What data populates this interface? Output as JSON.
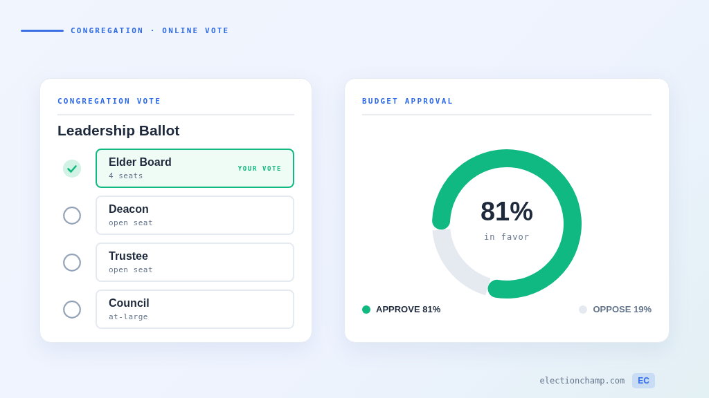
{
  "header": {
    "label": "CONGREGATION · ONLINE VOTE"
  },
  "ballot": {
    "eyebrow": "CONGREGATION VOTE",
    "title": "Leadership Ballot",
    "options": [
      {
        "name": "Elder Board",
        "detail": "4 seats",
        "selected": true,
        "badge": "YOUR VOTE"
      },
      {
        "name": "Deacon",
        "detail": "open seat",
        "selected": false
      },
      {
        "name": "Trustee",
        "detail": "open seat",
        "selected": false
      },
      {
        "name": "Council",
        "detail": "at-large",
        "selected": false
      }
    ]
  },
  "budget": {
    "eyebrow": "BUDGET APPROVAL",
    "center_value": "81%",
    "center_caption": "in favor",
    "chart_data": {
      "type": "donut",
      "categories": [
        "APPROVE",
        "OPPOSE"
      ],
      "values": [
        81,
        19
      ],
      "value_labels": [
        "81%",
        "19%"
      ],
      "colors": [
        "#10b981",
        "#e5e9f0"
      ]
    }
  },
  "footer": {
    "site": "electionchamp.com",
    "badge": "EC"
  }
}
